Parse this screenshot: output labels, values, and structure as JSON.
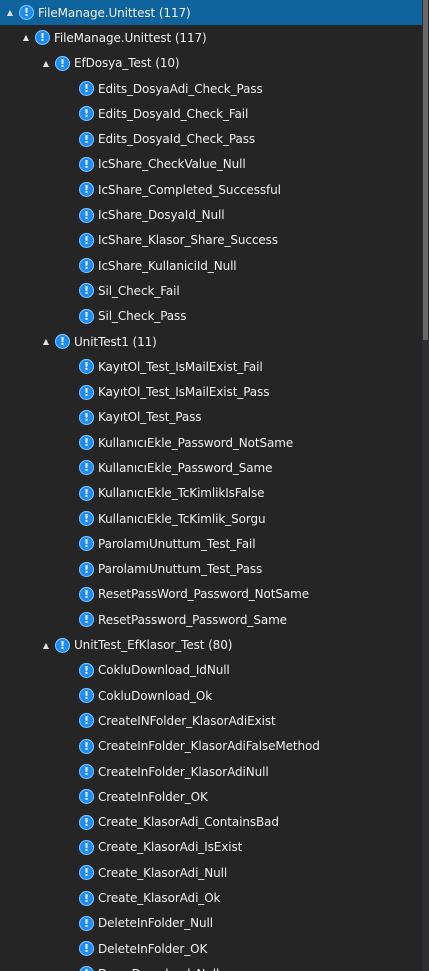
{
  "tree": [
    {
      "label": "FileManage.Unittest (117)",
      "level": 0,
      "expander": "▲",
      "selected": true
    },
    {
      "label": "FileManage.Unittest (117)",
      "level": 1,
      "expander": "▲"
    },
    {
      "label": "EfDosya_Test (10)",
      "level": 2,
      "expander": "▲"
    },
    {
      "label": "Edits_DosyaAdi_Check_Pass",
      "level": 3
    },
    {
      "label": "Edits_DosyaId_Check_Fail",
      "level": 3
    },
    {
      "label": "Edits_DosyaId_Check_Pass",
      "level": 3
    },
    {
      "label": "IcShare_CheckValue_Null",
      "level": 3
    },
    {
      "label": "IcShare_Completed_Successful",
      "level": 3
    },
    {
      "label": "IcShare_DosyaId_Null",
      "level": 3
    },
    {
      "label": "IcShare_Klasor_Share_Success",
      "level": 3
    },
    {
      "label": "IcShare_KullaniciId_Null",
      "level": 3
    },
    {
      "label": "Sil_Check_Fail",
      "level": 3
    },
    {
      "label": "Sil_Check_Pass",
      "level": 3
    },
    {
      "label": "UnitTest1 (11)",
      "level": 2,
      "expander": "▲"
    },
    {
      "label": "KayıtOl_Test_IsMailExist_Fail",
      "level": 3
    },
    {
      "label": "KayıtOl_Test_IsMailExist_Pass",
      "level": 3
    },
    {
      "label": "KayıtOl_Test_Pass",
      "level": 3
    },
    {
      "label": "KullanıcıEkle_Password_NotSame",
      "level": 3
    },
    {
      "label": "KullanıcıEkle_Password_Same",
      "level": 3
    },
    {
      "label": "KullanıcıEkle_TcKimlikIsFalse",
      "level": 3
    },
    {
      "label": "KullanıcıEkle_TcKimlik_Sorgu",
      "level": 3
    },
    {
      "label": "ParolamıUnuttum_Test_Fail",
      "level": 3
    },
    {
      "label": "ParolamıUnuttum_Test_Pass",
      "level": 3
    },
    {
      "label": "ResetPassWord_Password_NotSame",
      "level": 3
    },
    {
      "label": "ResetPassword_Password_Same",
      "level": 3
    },
    {
      "label": "UnitTest_EfKlasor_Test (80)",
      "level": 2,
      "expander": "▲"
    },
    {
      "label": "CokluDownload_IdNull",
      "level": 3
    },
    {
      "label": "CokluDownload_Ok",
      "level": 3
    },
    {
      "label": "CreateINFolder_KlasorAdiExist",
      "level": 3
    },
    {
      "label": "CreateInFolder_KlasorAdiFalseMethod",
      "level": 3
    },
    {
      "label": "CreateInFolder_KlasorAdiNull",
      "level": 3
    },
    {
      "label": "CreateInFolder_OK",
      "level": 3
    },
    {
      "label": "Create_KlasorAdi_ContainsBad",
      "level": 3
    },
    {
      "label": "Create_KlasorAdi_IsExist",
      "level": 3
    },
    {
      "label": "Create_KlasorAdi_Null",
      "level": 3
    },
    {
      "label": "Create_KlasorAdi_Ok",
      "level": 3
    },
    {
      "label": "DeleteInFolder_Null",
      "level": 3
    },
    {
      "label": "DeleteInFolder_OK",
      "level": 3
    },
    {
      "label": "DownDownload_Null",
      "level": 3
    }
  ],
  "icon_glyph": "!",
  "colors": {
    "selected": "#0e639c",
    "icon": "#1f8df0",
    "background": "#252526"
  }
}
